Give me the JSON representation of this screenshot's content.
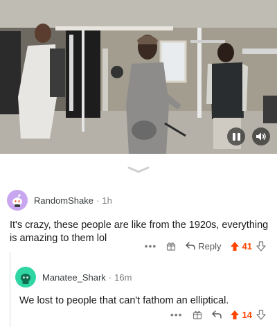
{
  "video": {
    "controls": [
      "pause-icon",
      "volume-icon"
    ]
  },
  "comments": [
    {
      "username": "RandomShake",
      "separator": "·",
      "time": "1h",
      "text": "It's crazy, these people are like from the 1920s, everything is amazing to them lol",
      "reply_label": "Reply",
      "score": "41",
      "avatar_color": "#c8a6f0"
    },
    {
      "username": "Manatee_Shark",
      "separator": "·",
      "time": "16m",
      "text": "We lost to people that can't fathom an elliptical.",
      "score": "14",
      "avatar_color": "#2fd6a3"
    }
  ],
  "colors": {
    "upvote": "#ff4500",
    "muted": "#7c7c7c"
  }
}
